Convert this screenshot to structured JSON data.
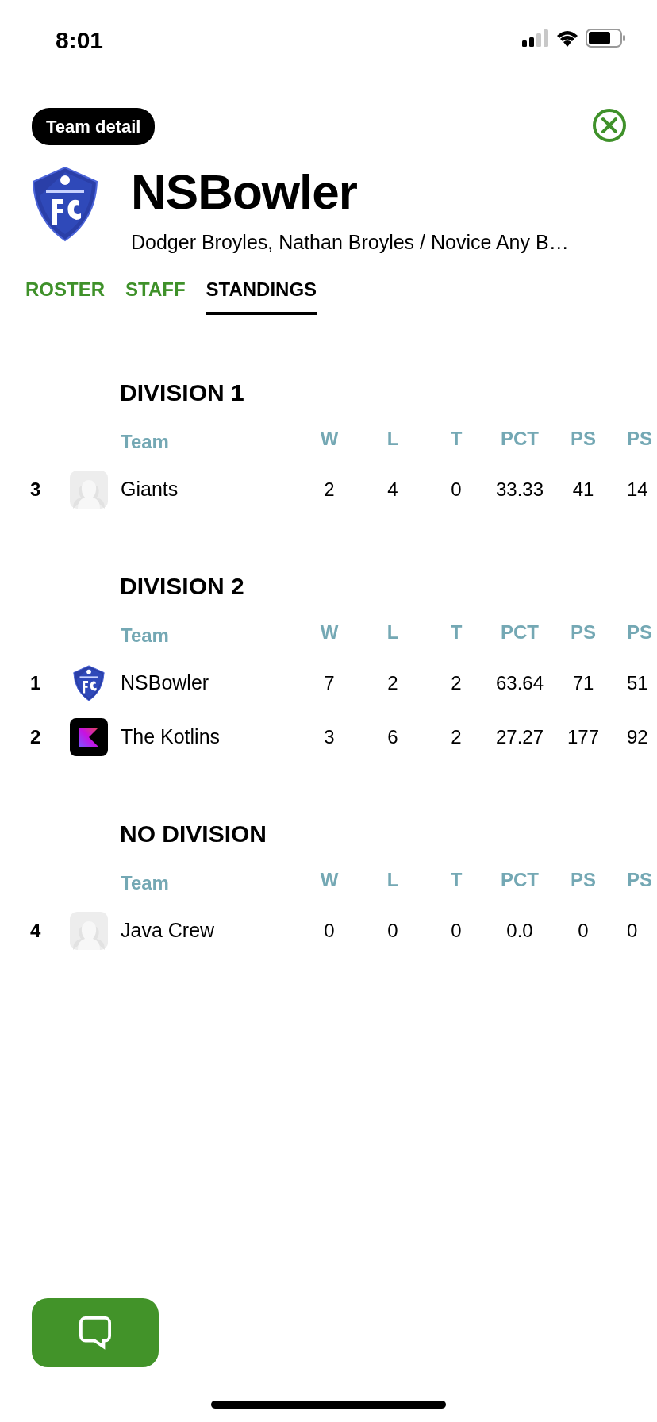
{
  "status_bar": {
    "time": "8:01"
  },
  "header": {
    "badge": "Team detail",
    "title": "NSBowler",
    "subtitle": "Dodger Broyles, Nathan Broyles / Novice Any B…"
  },
  "tabs": [
    {
      "label": "ROSTER",
      "selected": false
    },
    {
      "label": "STAFF",
      "selected": false
    },
    {
      "label": "STANDINGS",
      "selected": true
    }
  ],
  "divisions": [
    {
      "title": "DIVISION 1",
      "columns": [
        "Team",
        "W",
        "L",
        "T",
        "PCT",
        "PS",
        "PS"
      ],
      "rows": [
        {
          "rank": "3",
          "kind": "placeholder",
          "team": "Giants",
          "values": [
            "2",
            "4",
            "0",
            "33.33",
            "41",
            "14"
          ]
        }
      ]
    },
    {
      "title": "DIVISION 2",
      "columns": [
        "Team",
        "W",
        "L",
        "T",
        "PCT",
        "PS",
        "PS"
      ],
      "rows": [
        {
          "rank": "1",
          "kind": "shield",
          "team": "NSBowler",
          "values": [
            "7",
            "2",
            "2",
            "63.64",
            "71",
            "51"
          ]
        },
        {
          "rank": "2",
          "kind": "kotlin",
          "team": "The Kotlins",
          "values": [
            "3",
            "6",
            "2",
            "27.27",
            "177",
            "92"
          ]
        }
      ]
    },
    {
      "title": "NO DIVISION",
      "columns": [
        "Team",
        "W",
        "L",
        "T",
        "PCT",
        "PS",
        "PS"
      ],
      "rows": [
        {
          "rank": "4",
          "kind": "placeholder",
          "team": "Java Crew",
          "values": [
            "0",
            "0",
            "0",
            "0.0",
            "0",
            "0"
          ]
        }
      ]
    }
  ]
}
